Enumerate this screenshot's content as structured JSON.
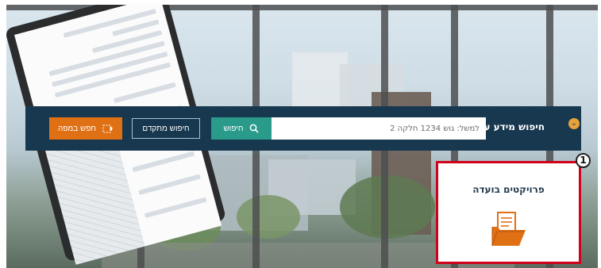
{
  "search_bar": {
    "label": "חיפוש מידע על",
    "input_placeholder": "למשל: גוש 1234 חלקה 2",
    "search_button": "חיפוש",
    "advanced_button": "חיפוש מתקדם",
    "map_search_button": "חפש במפה"
  },
  "card": {
    "title": "פרויקטים בועדה"
  },
  "annotation": {
    "badge_number": "1"
  },
  "colors": {
    "bar_background": "#17384f",
    "search_button": "#2a9b8b",
    "map_button": "#e07014",
    "highlight_border": "#d0021b",
    "accent": "#e8a23b"
  },
  "icons": {
    "dropdown": "chevron-down-icon",
    "search": "search-icon",
    "map": "map-pin-icon",
    "folder": "folder-icon"
  }
}
